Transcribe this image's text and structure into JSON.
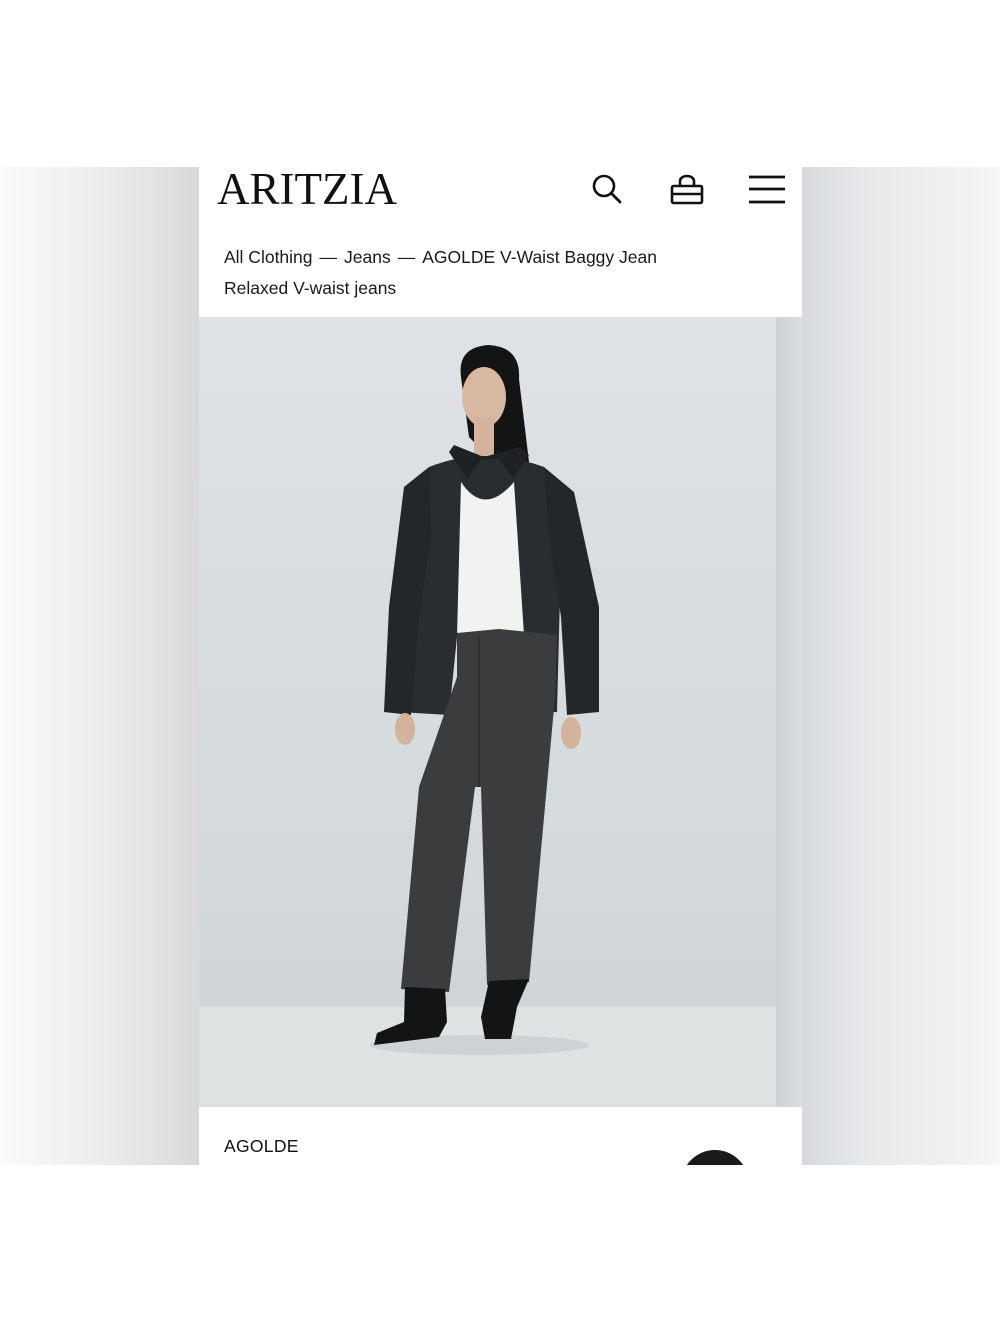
{
  "header": {
    "logo": "ARITZIA",
    "icons": [
      "search-icon",
      "shopping-bag-icon",
      "menu-icon"
    ]
  },
  "breadcrumb": {
    "items": [
      "All Clothing",
      "Jeans",
      "AGOLDE V-Waist Baggy Jean"
    ],
    "separator": "—"
  },
  "product": {
    "subtitle": "Relaxed V-waist jeans",
    "brand": "AGOLDE"
  },
  "colors": {
    "text": "#111111",
    "background": "#ffffff",
    "image_backdrop": "#d8dde0",
    "fab": "#1a1a1a"
  }
}
